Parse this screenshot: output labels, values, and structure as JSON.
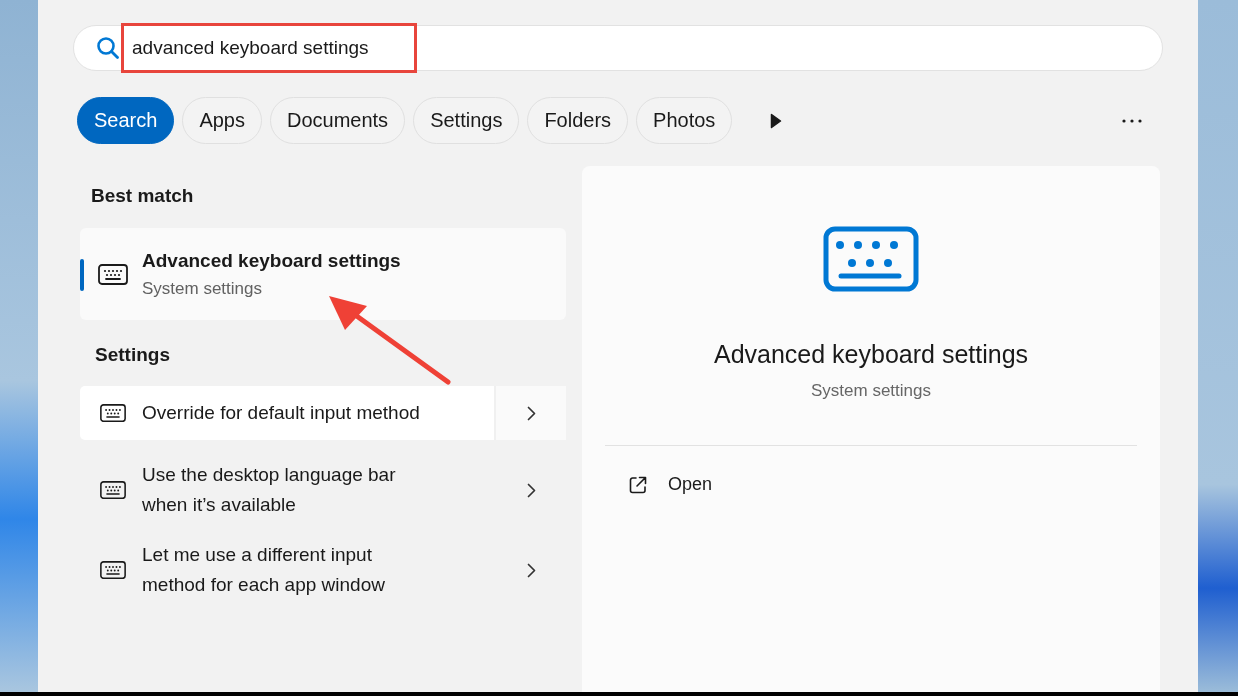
{
  "search": {
    "value": "advanced keyboard settings"
  },
  "tabs": [
    {
      "label": "Search",
      "selected": true
    },
    {
      "label": "Apps",
      "selected": false
    },
    {
      "label": "Documents",
      "selected": false
    },
    {
      "label": "Settings",
      "selected": false
    },
    {
      "label": "Folders",
      "selected": false
    },
    {
      "label": "Photos",
      "selected": false
    }
  ],
  "best_match": {
    "heading": "Best match",
    "title": "Advanced keyboard settings",
    "subtitle": "System settings",
    "selected": true
  },
  "settings_section": {
    "heading": "Settings",
    "items": [
      {
        "label": "Override for default input method",
        "highlighted": true
      },
      {
        "label": "Use the desktop language bar when it’s available",
        "highlighted": false
      },
      {
        "label": "Let me use a different input method for each app window",
        "highlighted": false
      }
    ]
  },
  "preview": {
    "title": "Advanced keyboard settings",
    "subtitle": "System settings",
    "actions": [
      {
        "label": "Open"
      }
    ]
  }
}
